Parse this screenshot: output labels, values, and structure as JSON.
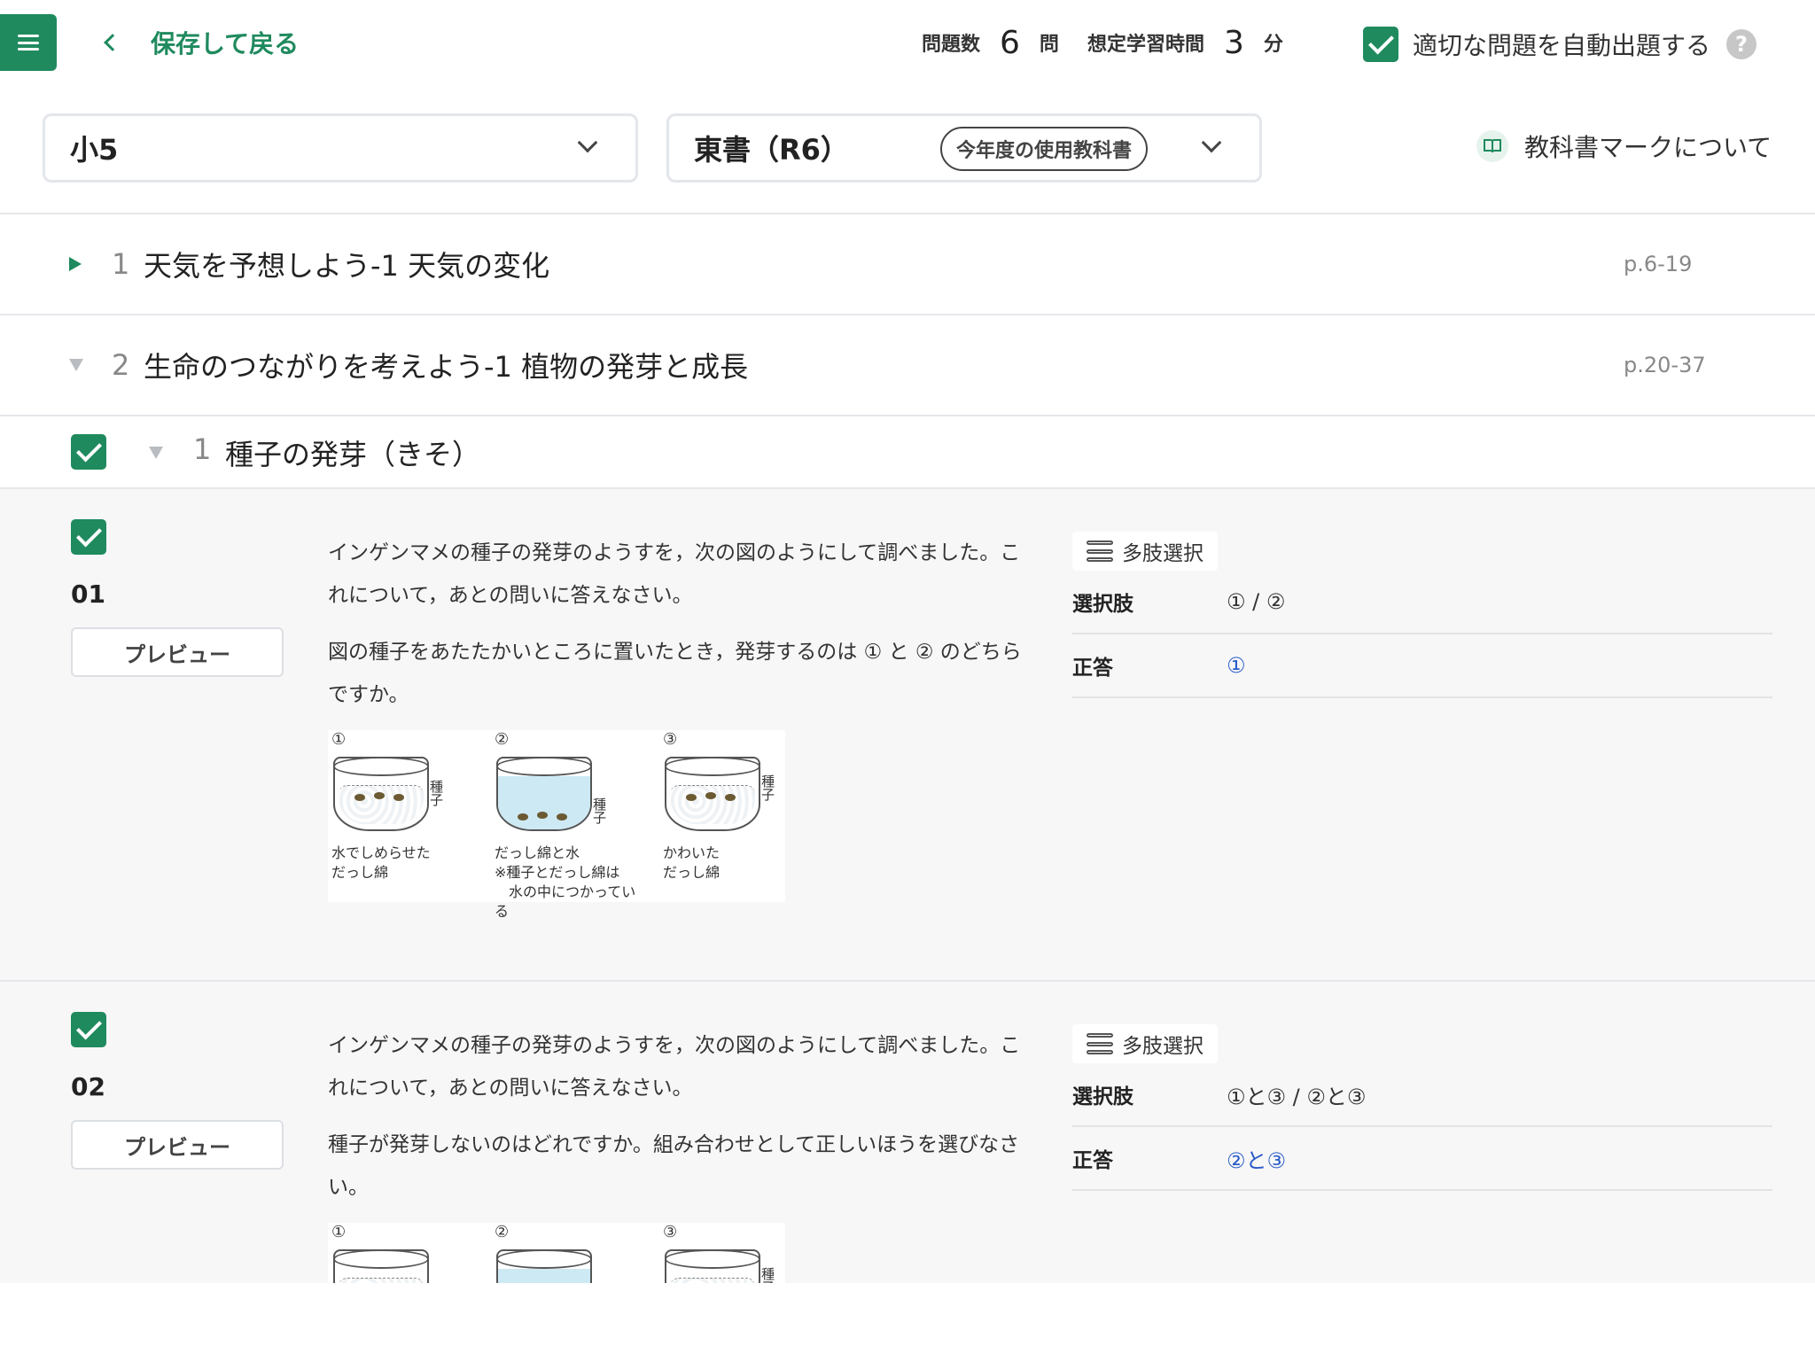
{
  "header": {
    "back_label": "保存して戻る",
    "count_label": "問題数",
    "count_value": "6",
    "count_unit": "問",
    "time_label": "想定学習時間",
    "time_value": "3",
    "time_unit": "分",
    "auto_label": "適切な問題を自動出題する",
    "help_glyph": "?"
  },
  "selects": {
    "grade": "小5",
    "textbook": "東書（R6）",
    "textbook_badge": "今年度の使用教科書",
    "mark_link": "教科書マークについて"
  },
  "units": [
    {
      "num": "1",
      "title": "天気を予想しよう-1 天気の変化",
      "pages": "p.6-19",
      "expanded": false
    },
    {
      "num": "2",
      "title": "生命のつながりを考えよう-1 植物の発芽と成長",
      "pages": "p.20-37",
      "expanded": true
    }
  ],
  "subunit": {
    "num": "1",
    "title": "種子の発芽（きそ）"
  },
  "questions": [
    {
      "no": "01",
      "preview_label": "プレビュー",
      "stem": "インゲンマメの種子の発芽のようすを，次の図のようにして調べました。これについて，あとの問いに答えなさい。",
      "question": "図の種子をあたたかいところに置いたとき，発芽するのは ① と ② のどちらですか。",
      "type": "多肢選択",
      "choices_label": "選択肢",
      "choices": "①  /  ②",
      "answer_label": "正答",
      "answer": "①"
    },
    {
      "no": "02",
      "preview_label": "プレビュー",
      "stem": "インゲンマメの種子の発芽のようすを，次の図のようにして調べました。これについて，あとの問いに答えなさい。",
      "question": "種子が発芽しないのはどれですか。組み合わせとして正しいほうを選びなさい。",
      "type": "多肢選択",
      "choices_label": "選択肢",
      "choices": "①と③  /  ②と③",
      "answer_label": "正答",
      "answer": "②と③"
    }
  ],
  "figure": {
    "labels": [
      "①",
      "②",
      "③"
    ],
    "seed_label": "種子",
    "captions": [
      "水でしめらせた\nだっし綿",
      "だっし綿と水\n※種子とだっし綿は\n　水の中につかっている",
      "かわいた\nだっし綿"
    ]
  },
  "colors": {
    "accent": "#1f8a5e",
    "answer": "#2a5cc9",
    "panel": "#f7f7f7"
  }
}
